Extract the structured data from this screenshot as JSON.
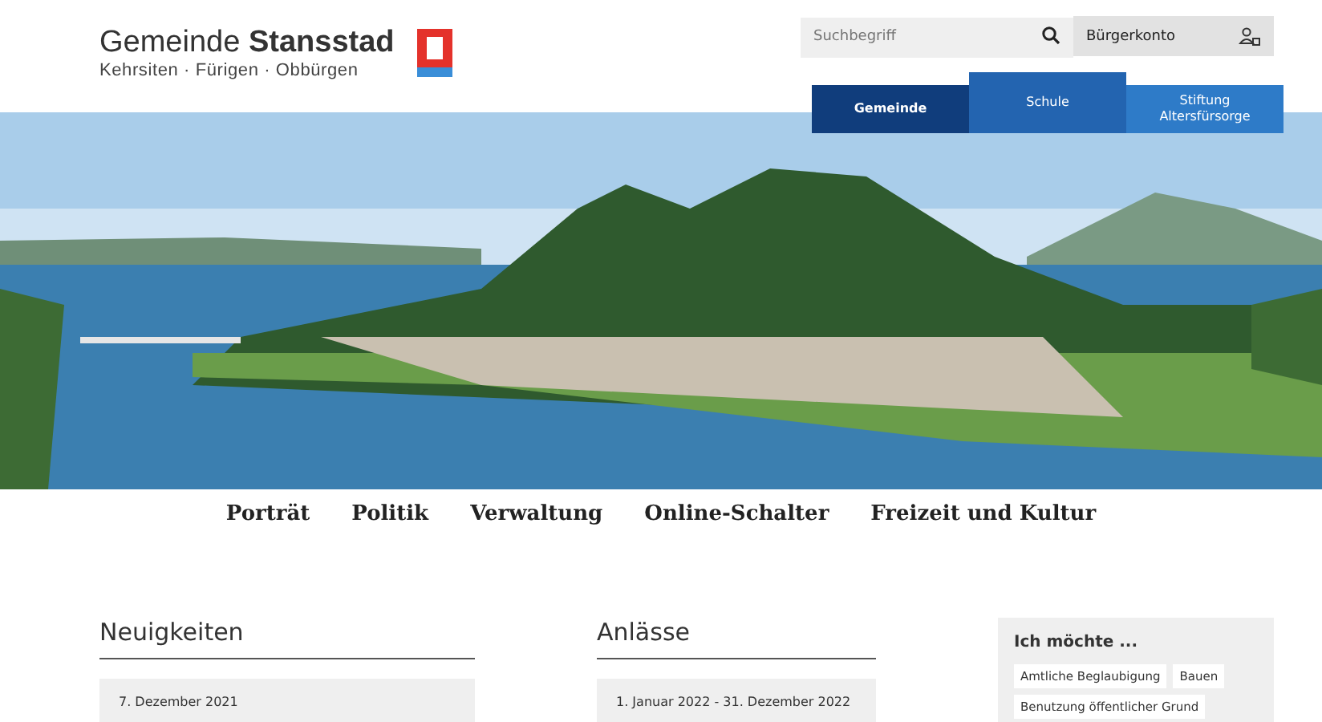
{
  "header": {
    "title_light": "Gemeinde",
    "title_bold": "Stansstad",
    "subtitle": "Kehrsiten · Fürigen · Obbürgen"
  },
  "search": {
    "placeholder": "Suchbegriff"
  },
  "account": {
    "label": "Bürgerkonto"
  },
  "tabs": [
    {
      "label": "Gemeinde",
      "selected": true,
      "raised": false
    },
    {
      "label": "Schule",
      "selected": false,
      "raised": true
    },
    {
      "label": "Stiftung Altersfürsorge",
      "selected": false,
      "raised": false
    }
  ],
  "nav": [
    "Porträt",
    "Politik",
    "Verwaltung",
    "Online-Schalter",
    "Freizeit und Kultur"
  ],
  "news": {
    "heading": "Neuigkeiten",
    "date": "7. Dezember 2021"
  },
  "events": {
    "heading": "Anlässe",
    "date": "1. Januar 2022 - 31. Dezember 2022"
  },
  "wants": {
    "heading": "Ich möchte ...",
    "tags": [
      "Amtliche Beglaubigung",
      "Bauen",
      "Benutzung öffentlicher Grund"
    ]
  }
}
